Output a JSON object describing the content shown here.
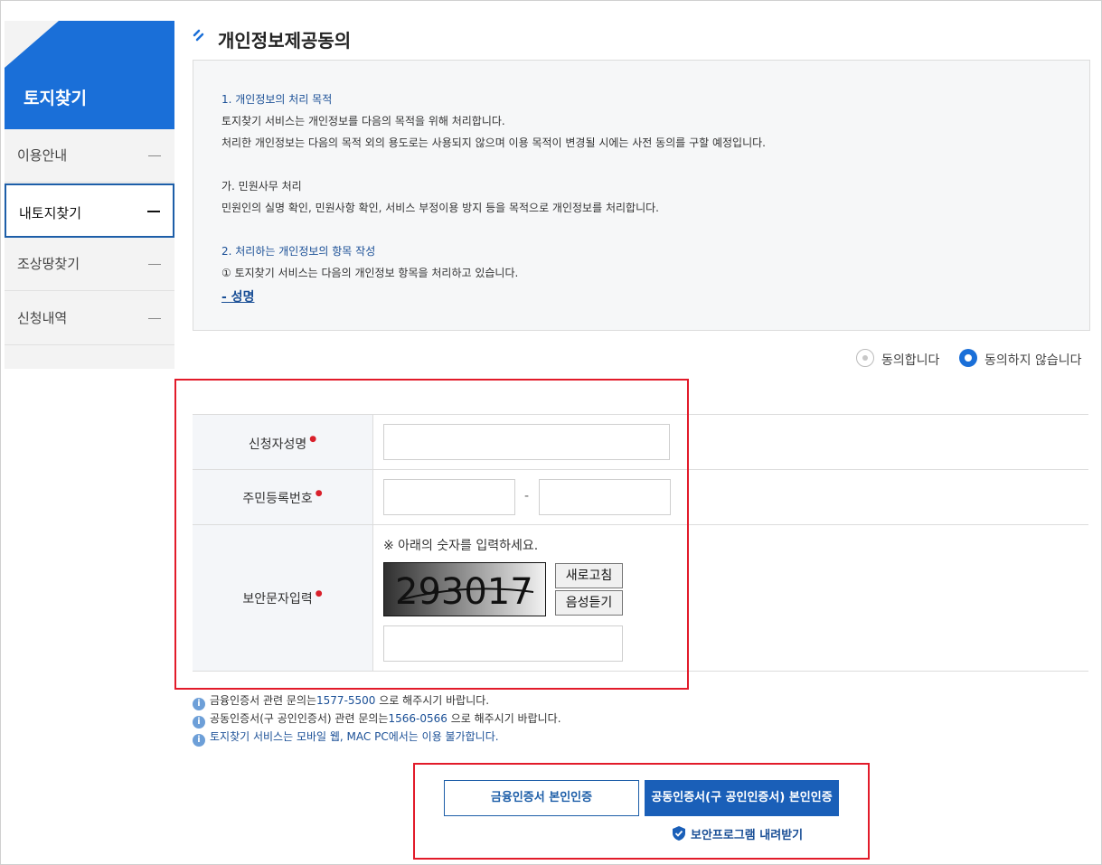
{
  "sidebar": {
    "title": "토지찾기",
    "items": [
      {
        "label": "이용안내"
      },
      {
        "label": "내토지찾기"
      },
      {
        "label": "조상땅찾기"
      },
      {
        "label": "신청내역"
      }
    ]
  },
  "page_title": "개인정보제공동의",
  "terms": {
    "h1": "1. 개인정보의 처리 목적",
    "l1": "토지찾기 서비스는 개인정보를 다음의 목적을 위해 처리합니다.",
    "l2": "처리한 개인정보는 다음의 목적 외의 용도로는 사용되지 않으며 이용 목적이 변경될 시에는 사전 동의를 구할 예정입니다.",
    "h2": "가. 민원사무 처리",
    "l3": "민원인의 실명 확인, 민원사항 확인, 서비스 부정이용 방지 등을 목적으로 개인정보를 처리합니다.",
    "h3": "2. 처리하는 개인정보의 항목 작성",
    "l4": "① 토지찾기 서비스는 다음의 개인정보 항목을 처리하고 있습니다.",
    "link": "- 성명"
  },
  "consent": {
    "agree": "동의합니다",
    "disagree": "동의하지 않습니다",
    "selected": "disagree"
  },
  "form": {
    "name_label": "신청자성명",
    "rrn_label": "주민등록번호",
    "rrn_sep": "-",
    "captcha_label": "보안문자입력",
    "required_mark": "●",
    "captcha_note": "※ 아래의 숫자를 입력하세요.",
    "captcha_value": "293017",
    "refresh_label": "새로고침",
    "audio_label": "음성듣기",
    "name_value": "",
    "rrn1_value": "",
    "rrn2_value": "",
    "captcha_input_value": ""
  },
  "notes": {
    "n1_pre": "금융인증서 관련 문의는",
    "n1_num": "1577-5500",
    "n1_post": " 으로 해주시기 바랍니다.",
    "n2_pre": "공동인증서(구 공인인증서) 관련 문의는",
    "n2_num": "1566-0566",
    "n2_post": " 으로 해주시기 바랍니다.",
    "n3": "토지찾기 서비스는 모바일 웹, MAC PC에서는 이용 불가합니다.",
    "icon": "i"
  },
  "auth": {
    "financial_cert": "금융인증서 본인인증",
    "joint_cert": "공동인증서(구 공인인증서) 본인인증",
    "download": "보안프로그램 내려받기"
  },
  "colors": {
    "primary": "#1a6fd8",
    "dark_blue": "#1d5ea8",
    "highlight_red": "#e21b2a"
  }
}
